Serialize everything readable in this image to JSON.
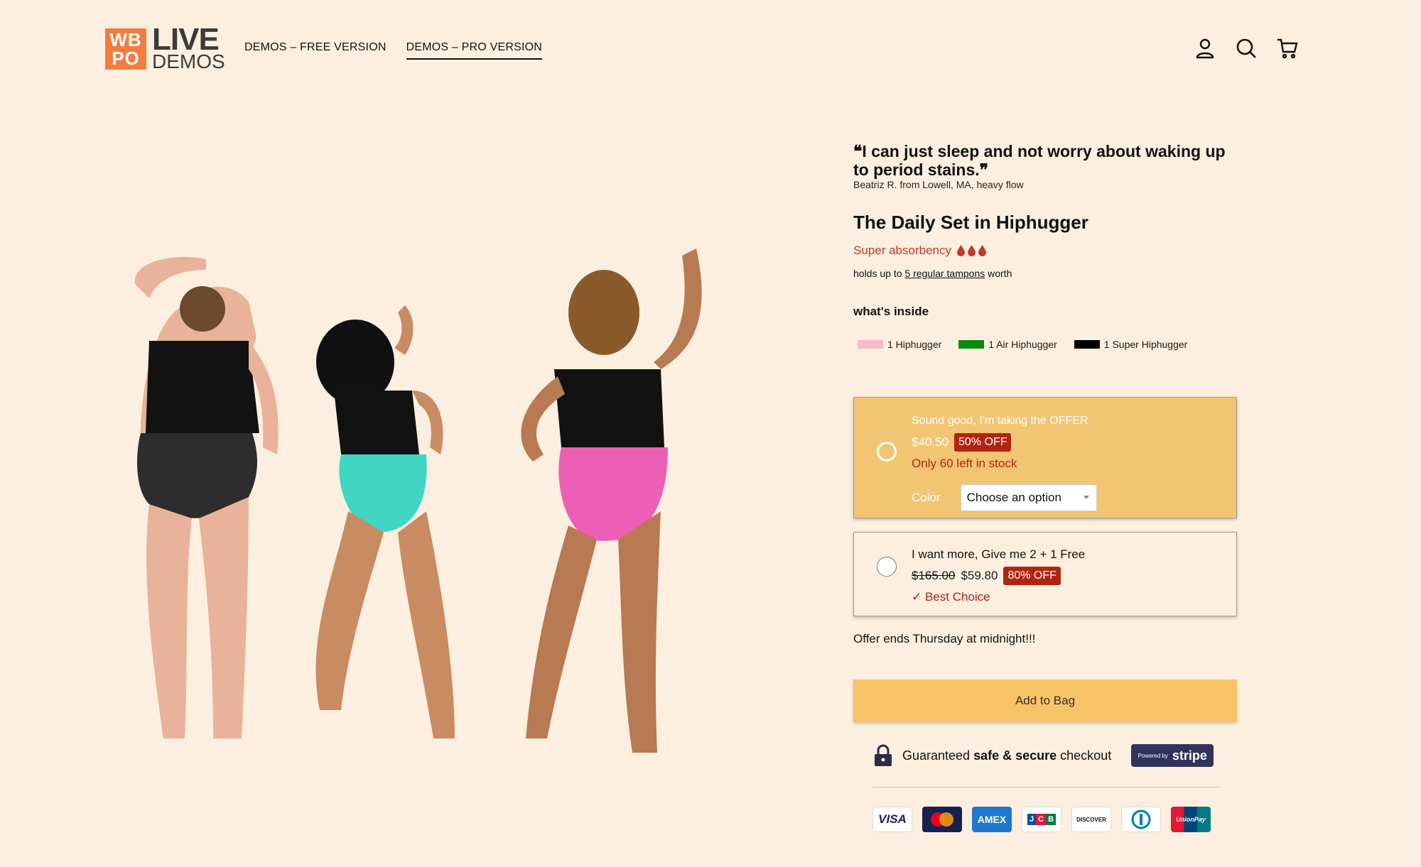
{
  "header": {
    "logo": {
      "box_line1": "WB",
      "box_line2": "PO",
      "live": "LIVE",
      "demos": "DEMOS"
    },
    "nav": [
      {
        "label": "DEMOS – FREE VERSION",
        "active": false
      },
      {
        "label": "DEMOS – PRO VERSION",
        "active": true
      }
    ],
    "icons": [
      "user-icon",
      "search-icon",
      "cart-icon"
    ]
  },
  "product": {
    "quote": "❝I can just sleep and not worry about waking up to period stains.❞",
    "quote_author": "Beatriz R. from Lowell, MA, heavy flow",
    "title": "The Daily Set in Hiphugger",
    "absorbency": "Super absorbency",
    "holds_prefix": "holds up to ",
    "holds_link": "5 regular tampons",
    "holds_suffix": " worth",
    "inside_title": "what's inside",
    "inside_items": [
      {
        "label": "1 Hiphugger",
        "color": "#f7b8c9"
      },
      {
        "label": "1 Air Hiphugger",
        "color": "#0a8a0a"
      },
      {
        "label": "1 Super Hiphugger",
        "color": "#000000"
      }
    ]
  },
  "offers": {
    "offer1": {
      "title": "Sound good, I'm taking the OFFER",
      "price": "$40.50",
      "badge": "50% OFF",
      "stock": "Only 60 left in stock",
      "color_label": "Color",
      "select_value": "Choose an option"
    },
    "offer2": {
      "title": "I want more, Give me 2 + 1 Free",
      "old_price": "$165.00",
      "price": "$59.80",
      "badge": "80% OFF",
      "best": "✓ Best Choice"
    }
  },
  "offer_ends": "Offer ends Thursday at midnight!!!",
  "add_to_bag": "Add to Bag",
  "secure": {
    "pre": "Guaranteed ",
    "bold": "safe & secure",
    "post": " checkout",
    "stripe_powered": "Powered by",
    "stripe_name": "stripe"
  },
  "cards": [
    "VISA",
    "Mastercard",
    "AMEX",
    "JCB",
    "DISCOVER",
    "Diners",
    "UnionPay"
  ],
  "colors": {
    "accent": "#f2c572",
    "badge": "#b22410",
    "background": "#fdefdf"
  }
}
